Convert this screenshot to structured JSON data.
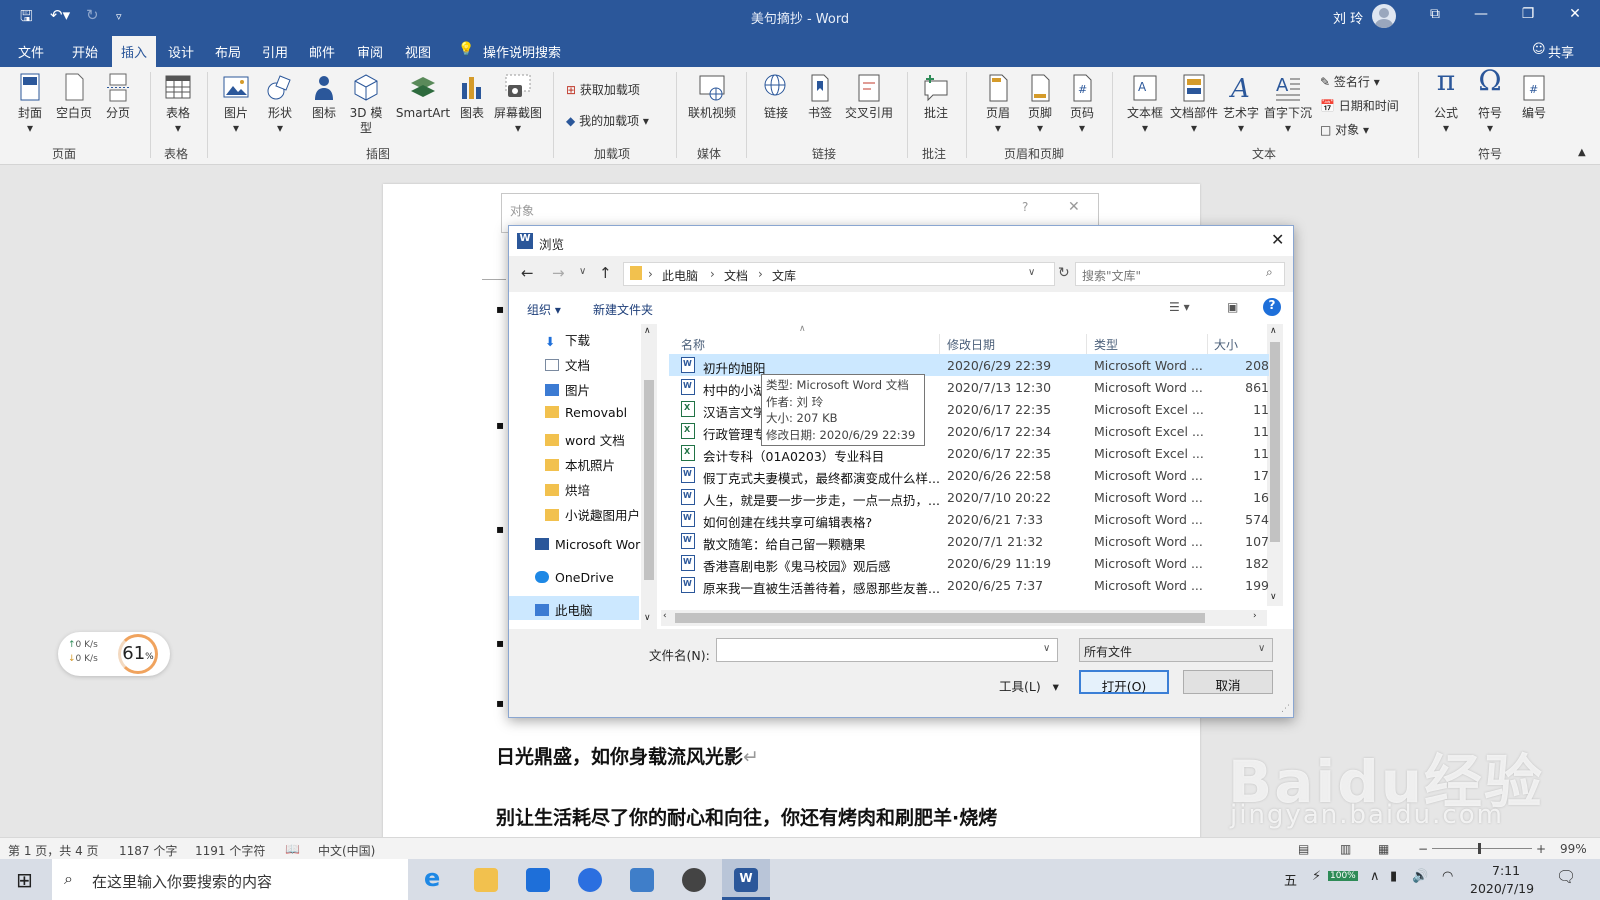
{
  "titlebar": {
    "title": "美句摘抄 - Word",
    "user": "刘 玲"
  },
  "tabs": [
    "文件",
    "开始",
    "插入",
    "设计",
    "布局",
    "引用",
    "邮件",
    "审阅",
    "视图"
  ],
  "tell_me": "操作说明搜索",
  "share": "共享",
  "ribbon": {
    "pages": [
      "封面",
      "空白页",
      "分页"
    ],
    "table": "表格",
    "illustrations": [
      "图片",
      "形状",
      "图标",
      "3D 模型",
      "SmartArt",
      "图表",
      "屏幕截图"
    ],
    "addins": [
      "获取加载项",
      "我的加载项"
    ],
    "media": "联机视频",
    "links": [
      "链接",
      "书签",
      "交叉引用"
    ],
    "comment": "批注",
    "header_footer": [
      "页眉",
      "页脚",
      "页码"
    ],
    "text": [
      "文本框",
      "文档部件",
      "艺术字",
      "首字下沉"
    ],
    "text_small": [
      "签名行",
      "日期和时间",
      "对象"
    ],
    "symbols": [
      "公式",
      "符号",
      "编号"
    ],
    "groups": [
      "页面",
      "表格",
      "插图",
      "加载项",
      "媒体",
      "链接",
      "批注",
      "页眉和页脚",
      "文本",
      "符号"
    ]
  },
  "object_dialog": {
    "title": "对象"
  },
  "browse": {
    "title": "浏览",
    "path": [
      "此电脑",
      "文档",
      "文库"
    ],
    "search_placeholder": "搜索\"文库\"",
    "organize": "组织",
    "new_folder": "新建文件夹",
    "nav": [
      "下载",
      "文档",
      "图片",
      "Removabl",
      "word 文档",
      "本机照片",
      "烘培",
      "小说趣图用户",
      "Microsoft Wor",
      "OneDrive",
      "此电脑"
    ],
    "columns": [
      "名称",
      "修改日期",
      "类型",
      "大小"
    ],
    "files": [
      {
        "name": "初升的旭阳",
        "date": "2020/6/29 22:39",
        "type": "Microsoft Word ...",
        "size": "208",
        "kind": "w"
      },
      {
        "name": "村中的小湖",
        "date": "2020/7/13 12:30",
        "type": "Microsoft Word ...",
        "size": "861",
        "kind": "w"
      },
      {
        "name": "汉语言文学",
        "date": "2020/6/17 22:35",
        "type": "Microsoft Excel ...",
        "size": "11",
        "kind": "x"
      },
      {
        "name": "行政管理专",
        "date": "2020/6/17 22:34",
        "type": "Microsoft Excel ...",
        "size": "11",
        "kind": "x"
      },
      {
        "name": "会计专科（01A0203）专业科目",
        "date": "2020/6/17 22:35",
        "type": "Microsoft Excel ...",
        "size": "11",
        "kind": "x"
      },
      {
        "name": "假丁克式夫妻模式，最终都演变成什么样...",
        "date": "2020/6/26 22:58",
        "type": "Microsoft Word ...",
        "size": "17",
        "kind": "w"
      },
      {
        "name": "人生，就是要一步一步走，一点一点扔，...",
        "date": "2020/7/10 20:22",
        "type": "Microsoft Word ...",
        "size": "16",
        "kind": "w"
      },
      {
        "name": "如何创建在线共享可编辑表格?",
        "date": "2020/6/21 7:33",
        "type": "Microsoft Word ...",
        "size": "574",
        "kind": "w"
      },
      {
        "name": "散文随笔：给自己留一颗糖果",
        "date": "2020/7/1 21:32",
        "type": "Microsoft Word ...",
        "size": "107",
        "kind": "w"
      },
      {
        "name": "香港喜剧电影《鬼马校园》观后感",
        "date": "2020/6/29 11:19",
        "type": "Microsoft Word ...",
        "size": "182",
        "kind": "w"
      },
      {
        "name": "原来我一直被生活善待着，感恩那些友善...",
        "date": "2020/6/25 7:37",
        "type": "Microsoft Word ...",
        "size": "199",
        "kind": "w"
      }
    ],
    "tooltip": [
      "类型: Microsoft Word 文档",
      "作者: 刘 玲",
      "大小: 207 KB",
      "修改日期: 2020/6/29 22:39"
    ],
    "filename_label": "文件名(N):",
    "filename_value": "",
    "filter": "所有文件",
    "tools": "工具(L)",
    "open": "打开(O)",
    "cancel": "取消"
  },
  "document": {
    "line1": "日光鼎盛，如你身载流风光影",
    "line2": "别让生活耗尽了你的耐心和向往，你还有烤肉和刷肥羊·烧烤"
  },
  "net_widget": {
    "up": "0  K/s",
    "down": "0  K/s",
    "percent": "61",
    "unit": "%"
  },
  "status": {
    "page": "第 1 页，共 4 页",
    "words": "1187 个字",
    "chars": "1191 个字符",
    "lang": "中文(中国)",
    "zoom": "99%"
  },
  "taskbar": {
    "search": "在这里输入你要搜索的内容",
    "ime": "五",
    "battery": "100%",
    "time": "7:11",
    "date": "2020/7/19"
  },
  "watermark": {
    "main": "Baidu经验",
    "sub": "jingyan.baidu.com"
  }
}
